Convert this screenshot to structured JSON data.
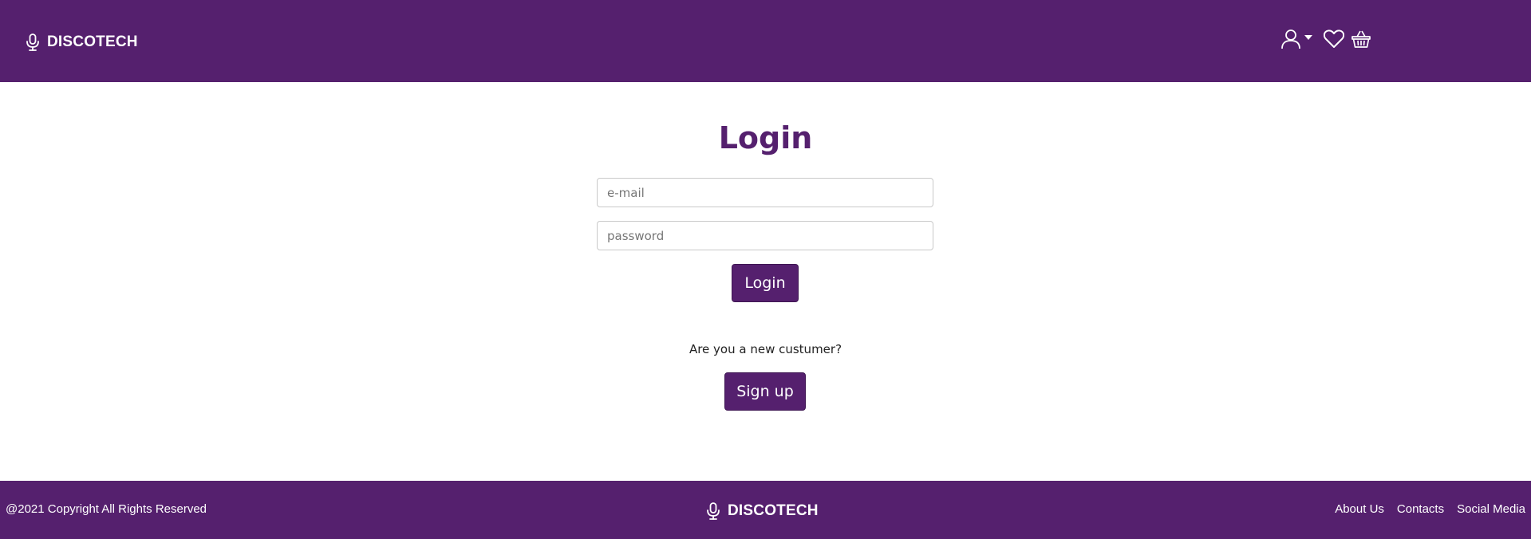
{
  "header": {
    "brand": "DISCOTECH",
    "icons": [
      "user-icon",
      "heart-icon",
      "basket-icon"
    ]
  },
  "login": {
    "title": "Login",
    "email_placeholder": "e-mail",
    "password_placeholder": "password",
    "login_button": "Login",
    "new_customer_prompt": "Are you a new custumer?",
    "signup_button": "Sign up"
  },
  "footer": {
    "copyright": "@2021 Copyright All Rights Reserved",
    "brand": "DISCOTECH",
    "links": [
      "About Us",
      "Contacts",
      "Social Media"
    ]
  },
  "colors": {
    "brand_purple": "#55206e",
    "background": "#ffffff"
  }
}
